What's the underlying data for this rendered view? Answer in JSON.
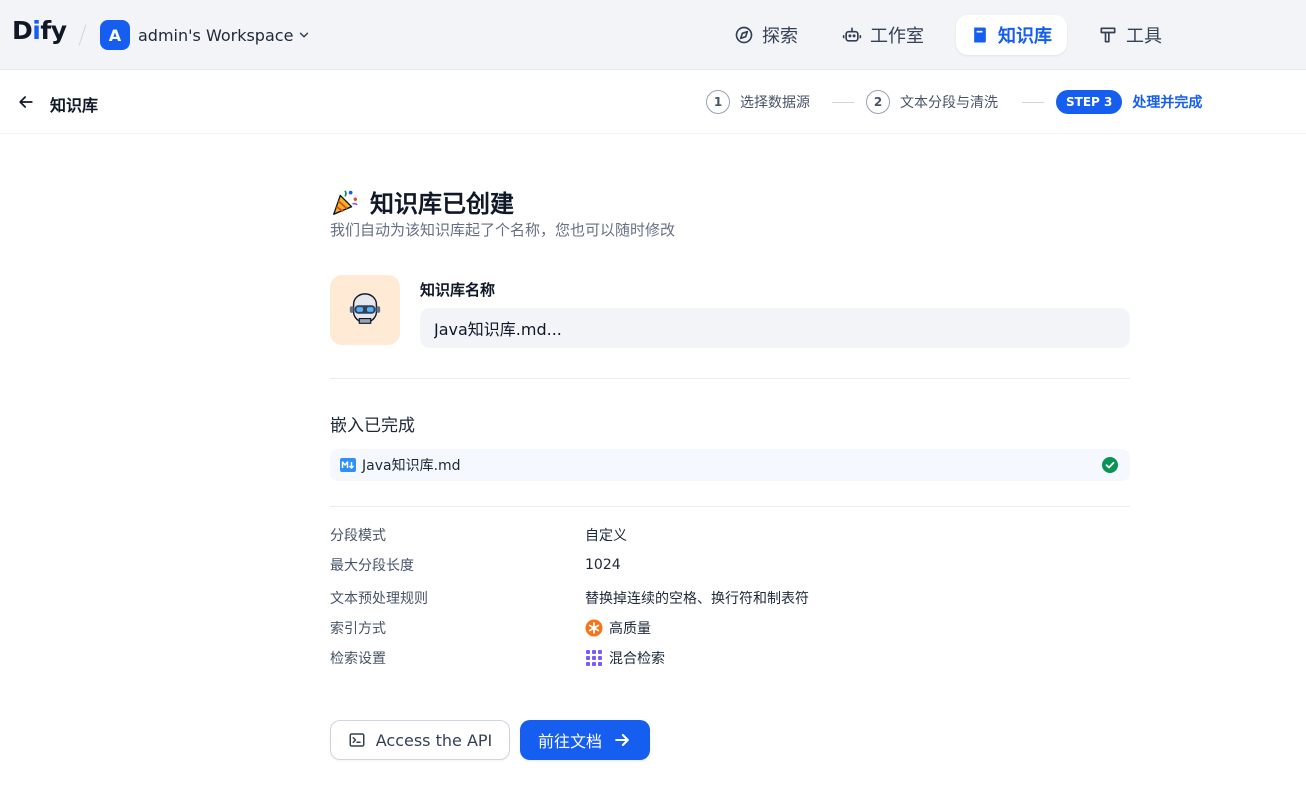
{
  "header": {
    "logo": {
      "d": "D",
      "i": "i",
      "fy": "fy"
    },
    "workspace": {
      "avatar_letter": "A",
      "name": "admin's Workspace"
    },
    "nav": [
      {
        "label": "探索",
        "icon": "compass-icon"
      },
      {
        "label": "工作室",
        "icon": "robot-icon"
      },
      {
        "label": "知识库",
        "icon": "book-icon",
        "active": true
      },
      {
        "label": "工具",
        "icon": "hammer-icon"
      }
    ]
  },
  "subheader": {
    "title": "知识库",
    "steps": [
      {
        "num": "1",
        "label": "选择数据源"
      },
      {
        "num": "2",
        "label": "文本分段与清洗"
      },
      {
        "badge": "STEP 3",
        "label": "处理并完成"
      }
    ]
  },
  "main": {
    "title": "知识库已创建",
    "subtitle": "我们自动为该知识库起了个名称，您也可以随时修改",
    "name_label": "知识库名称",
    "name_value": "Java知识库.md...",
    "embed_title": "嵌入已完成",
    "file_name": "Java知识库.md",
    "info": [
      {
        "label": "分段模式",
        "value": "自定义"
      },
      {
        "label": "最大分段长度",
        "value": "1024"
      },
      {
        "label": "文本预处理规则",
        "value": "替换掉连续的空格、换行符和制表符"
      },
      {
        "label": "索引方式",
        "value": "高质量"
      },
      {
        "label": "检索设置",
        "value": "混合检索"
      }
    ],
    "buttons": {
      "api": "Access the API",
      "docs": "前往文档"
    }
  },
  "colors": {
    "primary": "#155eef",
    "success": "#079455",
    "header_bg": "#f2f4f7"
  }
}
